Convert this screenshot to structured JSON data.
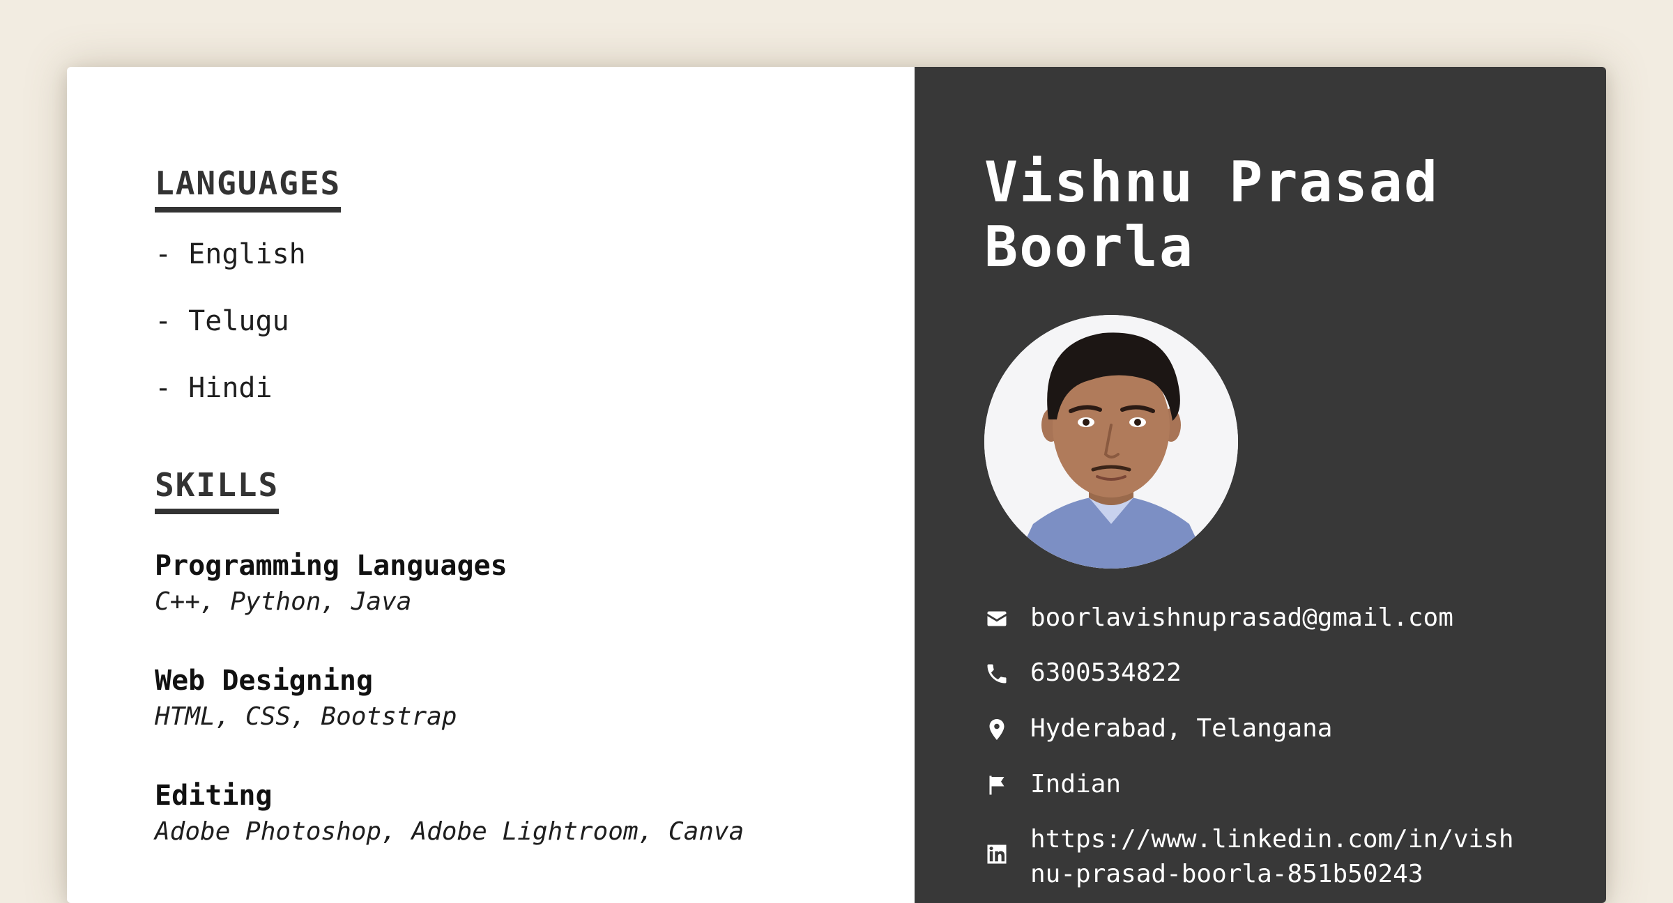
{
  "languages": {
    "heading": "LANGUAGES",
    "items": [
      "- English",
      "- Telugu",
      "- Hindi"
    ]
  },
  "skills": {
    "heading": "SKILLS",
    "groups": [
      {
        "title": "Programming Languages",
        "detail": "C++, Python, Java"
      },
      {
        "title": "Web Designing",
        "detail": "HTML, CSS, Bootstrap"
      },
      {
        "title": "Editing",
        "detail": "Adobe Photoshop, Adobe Lightroom, Canva"
      }
    ]
  },
  "profile": {
    "name": "Vishnu Prasad Boorla"
  },
  "contacts": {
    "email": "boorlavishnuprasad@gmail.com",
    "phone": "6300534822",
    "location": "Hyderabad, Telangana",
    "nationality": "Indian",
    "linkedin": "https://www.linkedin.com/in/vishnu-prasad-boorla-851b50243"
  },
  "icons": {
    "email": "envelope-icon",
    "phone": "phone-icon",
    "location": "map-pin-icon",
    "nationality": "flag-icon",
    "linkedin": "linkedin-icon"
  },
  "colors": {
    "sidebar": "#383838",
    "accent_text": "#333333",
    "background": "#f2ece1"
  }
}
